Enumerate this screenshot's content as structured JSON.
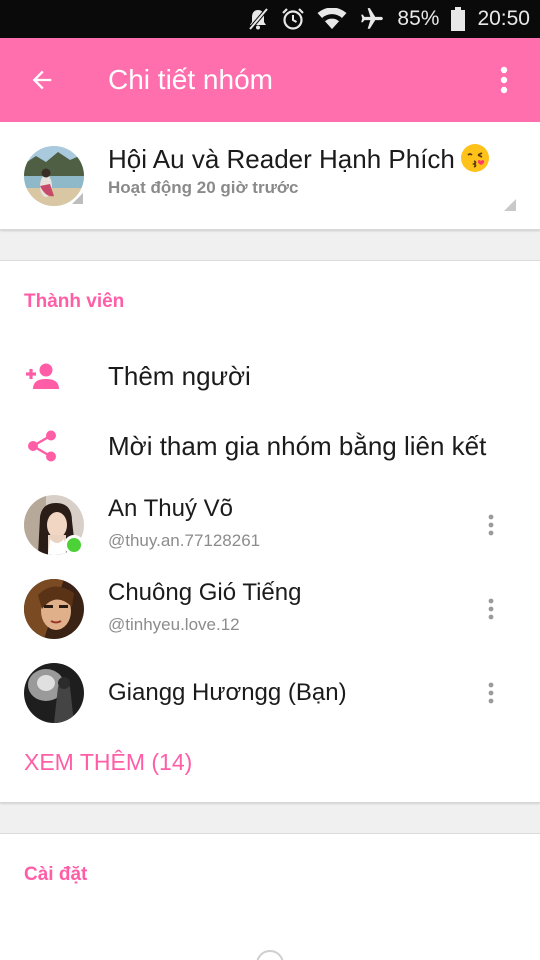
{
  "status_bar": {
    "battery": "85%",
    "time": "20:50",
    "icons": [
      "mute-icon",
      "alarm-icon",
      "wifi-icon",
      "airplane-icon",
      "battery-icon"
    ]
  },
  "app_bar": {
    "title": "Chi tiết nhóm",
    "color": "#ff6fae"
  },
  "group": {
    "name": "Hội Au và Reader Hạnh Phích",
    "activity": "Hoạt động 20 giờ trước"
  },
  "members_section": {
    "title": "Thành viên",
    "add_person": "Thêm người",
    "invite_link": "Mời tham gia nhóm bằng liên kết",
    "members": [
      {
        "name": "An Thuý Võ",
        "handle": "@thuy.an.77128261",
        "online": true
      },
      {
        "name": "Chuông Gió Tiếng",
        "handle": "@tinhyeu.love.12",
        "online": false
      },
      {
        "name": "Giangg Hươngg (Bạn)",
        "handle": "",
        "online": false
      }
    ],
    "see_more": "XEM THÊM (14)"
  },
  "settings_section": {
    "title": "Cài đặt"
  },
  "accent_color": "#ff5ea7",
  "online_color": "#4cd137"
}
